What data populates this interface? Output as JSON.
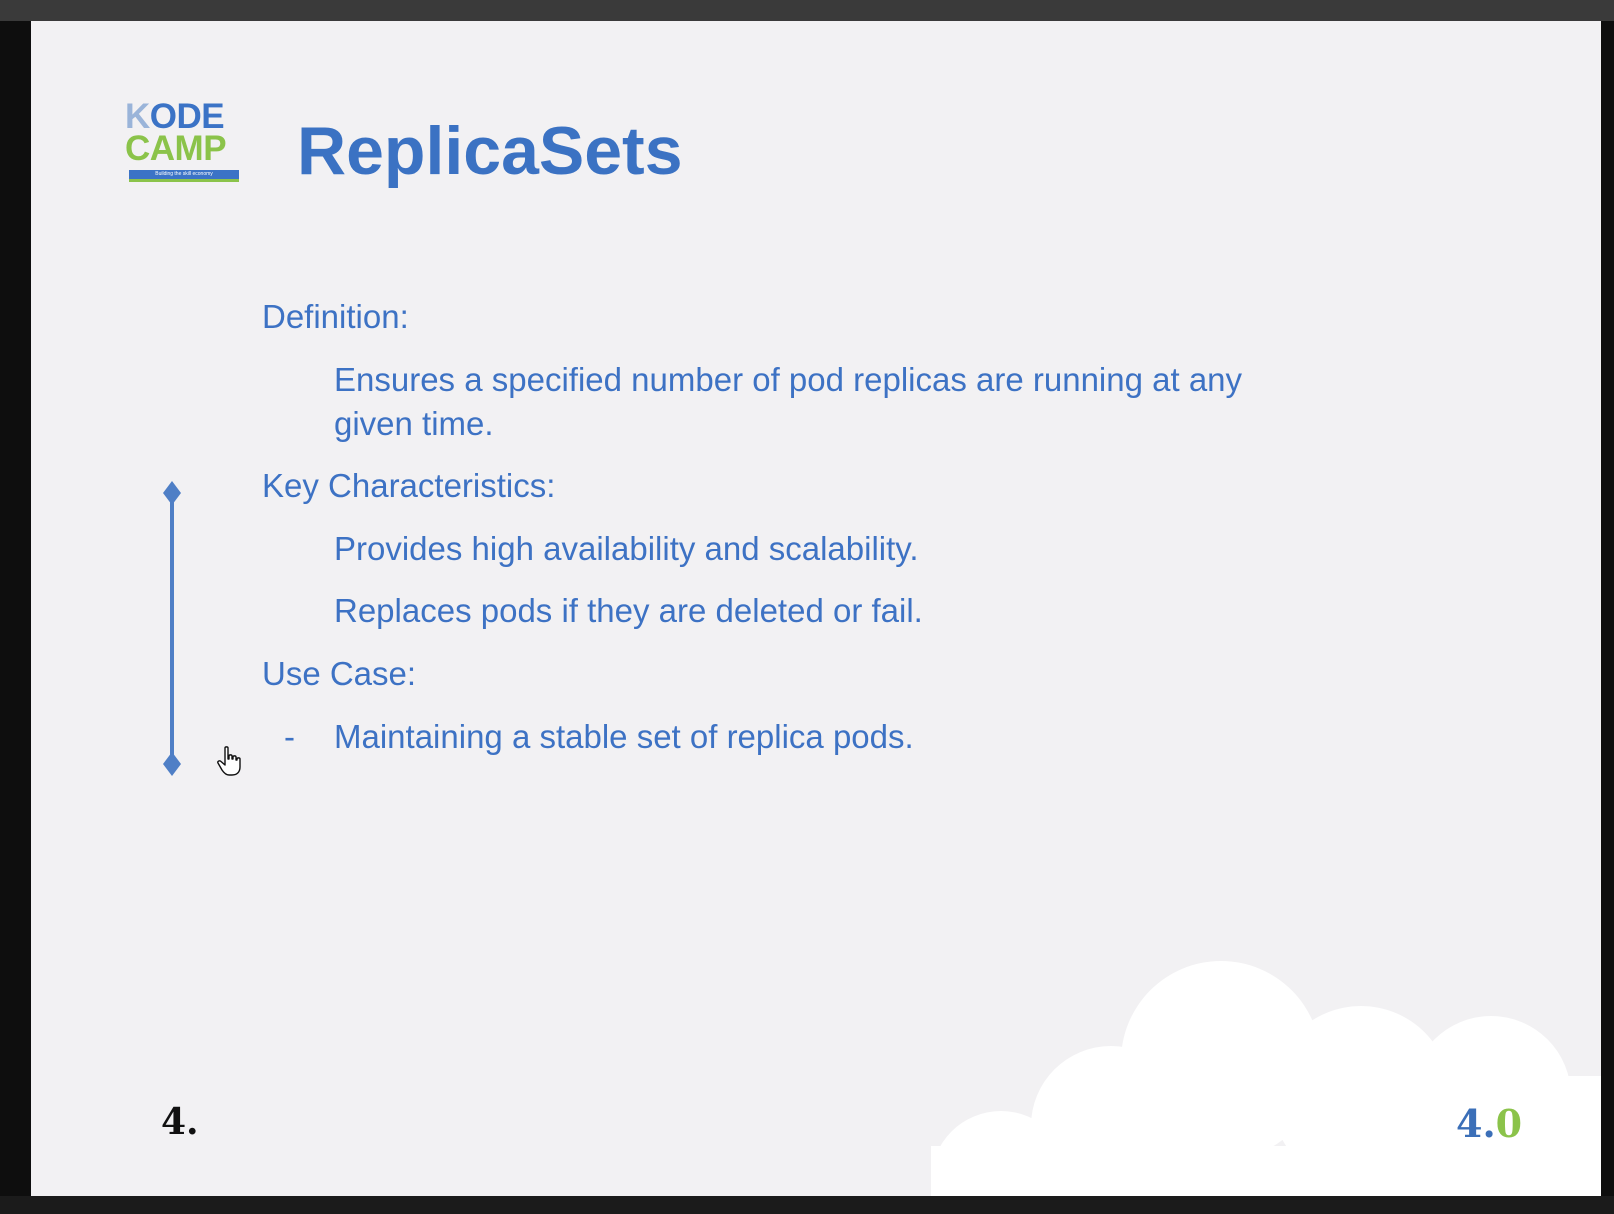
{
  "logo": {
    "line1_first": "K",
    "line1_rest": "ODE",
    "line2": "CAMP",
    "tagline": "Building the skill economy"
  },
  "slide": {
    "title": "ReplicaSets",
    "definition": {
      "heading": "Definition:",
      "line1": "Ensures a specified number of pod replicas are running at any",
      "line2": "given time."
    },
    "characteristics": {
      "heading": "Key Characteristics:",
      "item1": "Provides high availability and scalability.",
      "item2": "Replaces pods if they are deleted or fail."
    },
    "use_case": {
      "heading": "Use Case:",
      "bullet": "-",
      "item1": "Maintaining a stable set of replica pods."
    }
  },
  "footer": {
    "slide_number": "4.",
    "version_main": "4.",
    "version_tail": "0"
  },
  "colors": {
    "title": "#3b72c3",
    "body_text": "#3d72c4",
    "slide_background": "#f2f1f3",
    "accent_green": "#8bc34a"
  }
}
